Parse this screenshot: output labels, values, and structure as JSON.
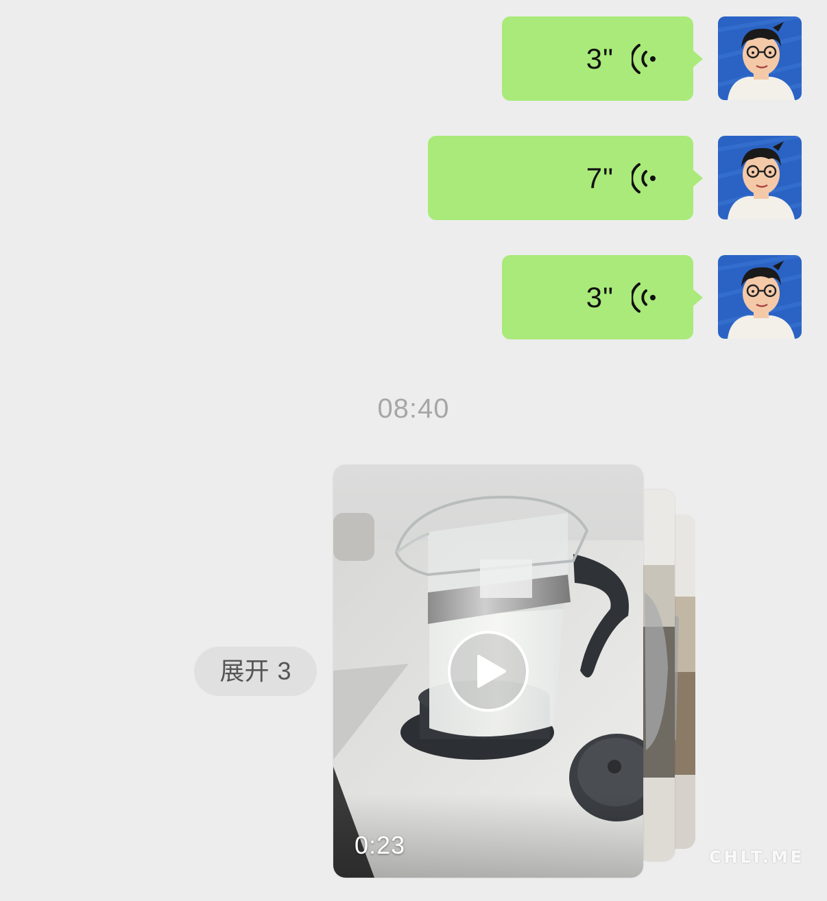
{
  "messages": [
    {
      "type": "voice",
      "duration": "3\"",
      "icon": "voice-waves-icon"
    },
    {
      "type": "voice",
      "duration": "7\"",
      "icon": "voice-waves-icon"
    },
    {
      "type": "voice",
      "duration": "3\"",
      "icon": "voice-waves-icon"
    }
  ],
  "timestamp": "08:40",
  "expand": {
    "label": "展开",
    "count": "3"
  },
  "video": {
    "duration": "0:23",
    "play_icon": "play-icon"
  },
  "watermark": "CHLT.ME",
  "colors": {
    "background": "#ededed",
    "bubble_green": "#a9ea7a",
    "avatar_blue": "#2a63c4",
    "timestamp_gray": "#a6a6a6",
    "pill_bg": "#e0e0e0"
  }
}
